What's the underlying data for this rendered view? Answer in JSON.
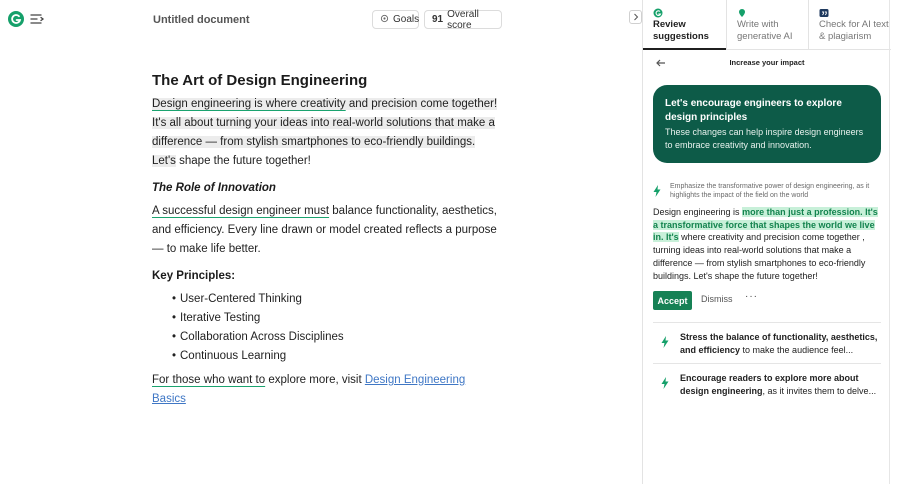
{
  "app": {
    "doc_title": "Untitled document",
    "goals_label": "Goals",
    "score_value": "91",
    "score_label": "Overall score"
  },
  "editor": {
    "title": "The Art of Design Engineering",
    "p1": {
      "hl_underlined": "Design engineering is where creativity",
      "hl_rest": " and precision come together! It's all about turning your ideas into real-world solutions that make a difference — from stylish smartphones to eco-friendly buildings. Let's",
      "plain": " shape the future together!"
    },
    "section_title": "The Role of Innovation",
    "p2": {
      "underlined": "A successful design engineer must",
      "rest": " balance functionality, aesthetics, and efficiency. Every line drawn or model created reflects a purpose — to make life better."
    },
    "key_title": "Key Principles:",
    "bullets": [
      "User-Centered Thinking",
      "Iterative Testing",
      "Collaboration Across Disciplines",
      "Continuous Learning"
    ],
    "p3": {
      "underlined": "For those who want to",
      "rest": " explore more, visit ",
      "link": "Design Engineering Basics"
    }
  },
  "panel": {
    "tabs": [
      {
        "label": "Review suggestions",
        "icon": "grammarly-icon"
      },
      {
        "label": "Write with generative AI",
        "icon": "pen-icon"
      },
      {
        "label": "Check for AI text & plagiarism",
        "icon": "quote-icon"
      }
    ],
    "sub_title": "Increase your impact",
    "banner_title": "Let's encourage engineers to explore design principles",
    "banner_text": "These changes can help inspire design engineers to embrace creativity and innovation.",
    "suggestion": {
      "caption": "Emphasize the transformative power of design engineering, as it highlights the impact of the field on the world",
      "pre": "Design engineering is ",
      "insert": "more than just a profession. It's a transformative force that shapes the world we live in. It's",
      "post": " where creativity and precision come together , turning ideas into real-world solutions that make a difference — from stylish smartphones to eco-friendly buildings. Let's shape the future together!",
      "accept": "Accept",
      "dismiss": "Dismiss",
      "more": "···"
    },
    "cards": [
      {
        "bold": "Stress the balance of functionality, aesthetics, and efficiency",
        "rest": " to make the audience feel..."
      },
      {
        "bold": "Encourage readers to explore more about design engineering",
        "rest": ", as it invites them to delve..."
      }
    ],
    "accent_color": "#0d5b48",
    "brand_color": "#15a06a"
  }
}
